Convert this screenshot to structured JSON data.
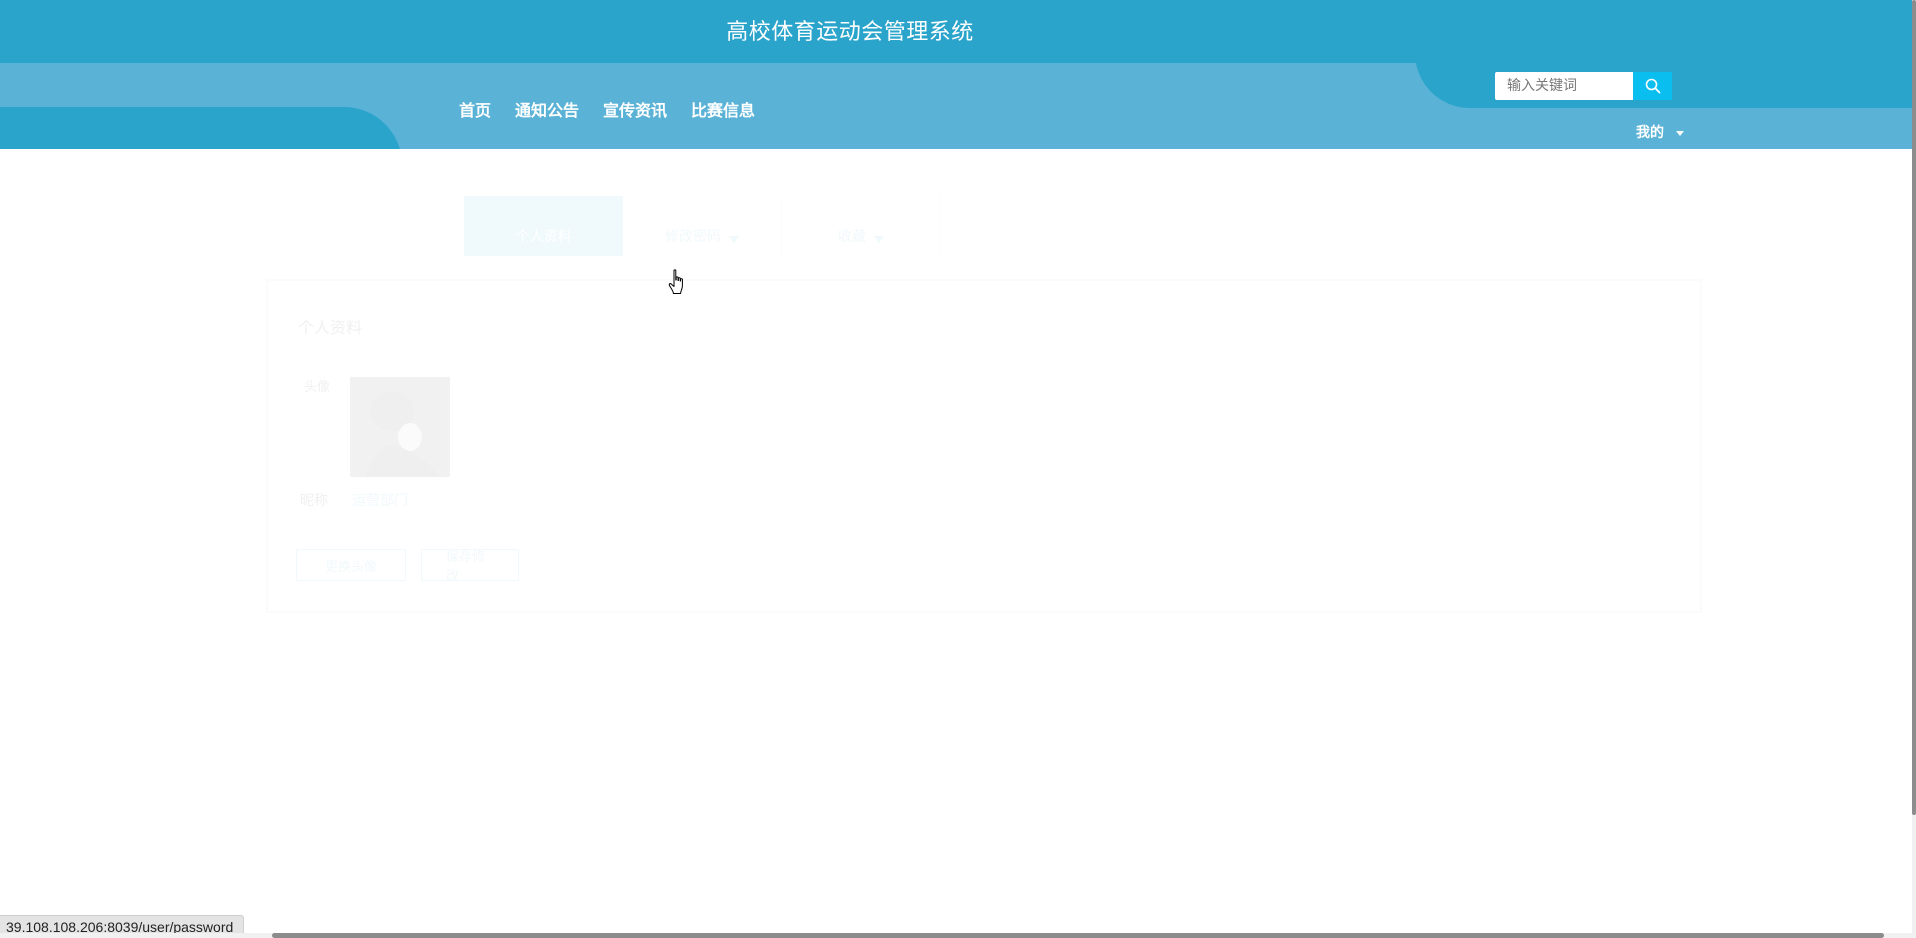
{
  "header": {
    "site_title": "高校体育运动会管理系统",
    "nav": [
      {
        "label": "首页"
      },
      {
        "label": "通知公告"
      },
      {
        "label": "宣传资讯"
      },
      {
        "label": "比赛信息"
      }
    ],
    "search": {
      "placeholder": "输入关键词",
      "value": "",
      "icon": "search-icon"
    },
    "user_menu": {
      "label": "我的",
      "icon": "caret-down-icon"
    }
  },
  "main": {
    "tabs": [
      {
        "label": "个人资料",
        "active": true
      },
      {
        "label": "修改密码",
        "has_caret": true
      },
      {
        "label": "收藏",
        "has_caret": true
      }
    ],
    "profile": {
      "title": "个人资料",
      "avatar_label": "头像",
      "name_label": "昵称",
      "name_value": "运营部门",
      "buttons": [
        {
          "label": "更换头像"
        },
        {
          "label": "保存修改"
        }
      ]
    }
  },
  "status_bar": {
    "url": "39.108.108.206:8039/user/password"
  },
  "colors": {
    "top_bar": "#2aa4cb",
    "nav_bar": "#5ab2d6",
    "search_button": "#0abef0",
    "accent": "#2aa4cb"
  }
}
